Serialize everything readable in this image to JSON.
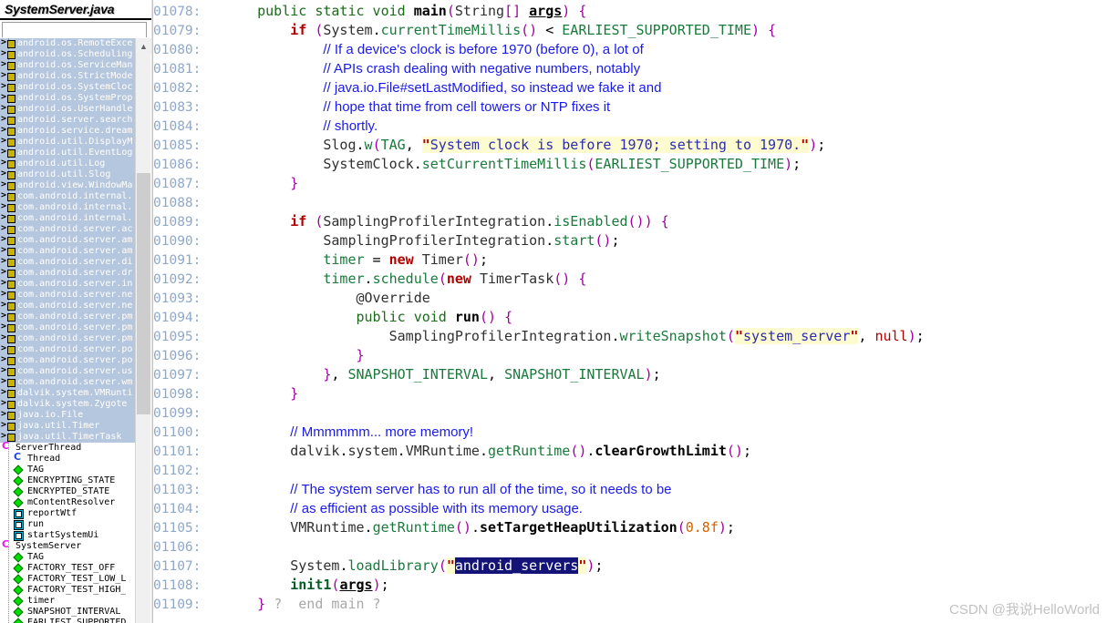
{
  "sidebar": {
    "file_tab_label": "SystemServer.java",
    "search_placeholder": "",
    "search_value": "",
    "icons": {
      "import": "import-icon",
      "class": "class-icon",
      "superclass": "superclass-icon",
      "field": "field-icon",
      "method": "method-icon",
      "scroll_up": "scroll-up-arrow-icon"
    },
    "scroll_up_glyph": "▲",
    "tree": [
      {
        "icon": "import",
        "label": "android.os.RemoteExce",
        "selected": true,
        "indent": 0
      },
      {
        "icon": "import",
        "label": "android.os.Scheduling",
        "selected": true,
        "indent": 0
      },
      {
        "icon": "import",
        "label": "android.os.ServiceMan",
        "selected": true,
        "indent": 0
      },
      {
        "icon": "import",
        "label": "android.os.StrictMode",
        "selected": true,
        "indent": 0
      },
      {
        "icon": "import",
        "label": "android.os.SystemCloc",
        "selected": true,
        "indent": 0
      },
      {
        "icon": "import",
        "label": "android.os.SystemProp",
        "selected": true,
        "indent": 0
      },
      {
        "icon": "import",
        "label": "android.os.UserHandle",
        "selected": true,
        "indent": 0
      },
      {
        "icon": "import",
        "label": "android.server.search",
        "selected": true,
        "indent": 0
      },
      {
        "icon": "import",
        "label": "android.service.dream",
        "selected": true,
        "indent": 0
      },
      {
        "icon": "import",
        "label": "android.util.DisplayM",
        "selected": true,
        "indent": 0
      },
      {
        "icon": "import",
        "label": "android.util.EventLog",
        "selected": true,
        "indent": 0
      },
      {
        "icon": "import",
        "label": "android.util.Log",
        "selected": true,
        "indent": 0
      },
      {
        "icon": "import",
        "label": "android.util.Slog",
        "selected": true,
        "indent": 0
      },
      {
        "icon": "import",
        "label": "android.view.WindowMa",
        "selected": true,
        "indent": 0
      },
      {
        "icon": "import",
        "label": "com.android.internal.",
        "selected": true,
        "indent": 0
      },
      {
        "icon": "import",
        "label": "com.android.internal.",
        "selected": true,
        "indent": 0
      },
      {
        "icon": "import",
        "label": "com.android.internal.",
        "selected": true,
        "indent": 0
      },
      {
        "icon": "import",
        "label": "com.android.server.ac",
        "selected": true,
        "indent": 0
      },
      {
        "icon": "import",
        "label": "com.android.server.am",
        "selected": true,
        "indent": 0
      },
      {
        "icon": "import",
        "label": "com.android.server.am",
        "selected": true,
        "indent": 0
      },
      {
        "icon": "import",
        "label": "com.android.server.di",
        "selected": true,
        "indent": 0
      },
      {
        "icon": "import",
        "label": "com.android.server.dr",
        "selected": true,
        "indent": 0
      },
      {
        "icon": "import",
        "label": "com.android.server.in",
        "selected": true,
        "indent": 0
      },
      {
        "icon": "import",
        "label": "com.android.server.ne",
        "selected": true,
        "indent": 0
      },
      {
        "icon": "import",
        "label": "com.android.server.ne",
        "selected": true,
        "indent": 0
      },
      {
        "icon": "import",
        "label": "com.android.server.pm",
        "selected": true,
        "indent": 0
      },
      {
        "icon": "import",
        "label": "com.android.server.pm",
        "selected": true,
        "indent": 0
      },
      {
        "icon": "import",
        "label": "com.android.server.pm",
        "selected": true,
        "indent": 0
      },
      {
        "icon": "import",
        "label": "com.android.server.po",
        "selected": true,
        "indent": 0
      },
      {
        "icon": "import",
        "label": "com.android.server.po",
        "selected": true,
        "indent": 0
      },
      {
        "icon": "import",
        "label": "com.android.server.us",
        "selected": true,
        "indent": 0
      },
      {
        "icon": "import",
        "label": "com.android.server.wm",
        "selected": true,
        "indent": 0
      },
      {
        "icon": "import",
        "label": "dalvik.system.VMRunti",
        "selected": true,
        "indent": 0
      },
      {
        "icon": "import",
        "label": "dalvik.system.Zygote",
        "selected": true,
        "indent": 0
      },
      {
        "icon": "import",
        "label": "java.io.File",
        "selected": true,
        "indent": 0
      },
      {
        "icon": "import",
        "label": "java.util.Timer",
        "selected": true,
        "indent": 0
      },
      {
        "icon": "import",
        "label": "java.util.TimerTask",
        "selected": true,
        "indent": 0
      },
      {
        "icon": "class",
        "label": "ServerThread",
        "selected": false,
        "indent": 0
      },
      {
        "icon": "superclass",
        "label": "Thread",
        "selected": false,
        "indent": 1
      },
      {
        "icon": "field",
        "label": "TAG",
        "selected": false,
        "indent": 1
      },
      {
        "icon": "field",
        "label": "ENCRYPTING_STATE",
        "selected": false,
        "indent": 1
      },
      {
        "icon": "field",
        "label": "ENCRYPTED_STATE",
        "selected": false,
        "indent": 1
      },
      {
        "icon": "field",
        "label": "mContentResolver",
        "selected": false,
        "indent": 1
      },
      {
        "icon": "method",
        "label": "reportWtf",
        "selected": false,
        "indent": 1
      },
      {
        "icon": "method",
        "label": "run",
        "selected": false,
        "indent": 1
      },
      {
        "icon": "method",
        "label": "startSystemUi",
        "selected": false,
        "indent": 1
      },
      {
        "icon": "class",
        "label": "SystemServer",
        "selected": false,
        "indent": 0
      },
      {
        "icon": "field",
        "label": "TAG",
        "selected": false,
        "indent": 1
      },
      {
        "icon": "field",
        "label": "FACTORY_TEST_OFF",
        "selected": false,
        "indent": 1
      },
      {
        "icon": "field",
        "label": "FACTORY_TEST_LOW_L",
        "selected": false,
        "indent": 1
      },
      {
        "icon": "field",
        "label": "FACTORY_TEST_HIGH_",
        "selected": false,
        "indent": 1
      },
      {
        "icon": "field",
        "label": "timer",
        "selected": false,
        "indent": 1
      },
      {
        "icon": "field",
        "label": "SNAPSHOT_INTERVAL",
        "selected": false,
        "indent": 1
      },
      {
        "icon": "field",
        "label": "EARLIEST_SUPPORTED",
        "selected": false,
        "indent": 1
      }
    ]
  },
  "editor": {
    "first_line_number": 1078,
    "selection_text": "android_servers",
    "lines": [
      {
        "n": "01078:",
        "html": "    <span class='kw2'>public static void</span> <span class='mthb'>main</span><span class='br'>(</span><span class='typ'>String</span><span class='br'>[]</span> <span class='und'>args</span><span class='br'>)</span> <span class='br'>{</span>"
      },
      {
        "n": "01079:",
        "html": "        <span class='kw'>if</span> <span class='br'>(</span><span class='typ'>System</span>.<span class='mth'>currentTimeMillis</span><span class='br'>()</span> &lt; <span class='fld'>EARLIEST_SUPPORTED_TIME</span><span class='br'>)</span> <span class='br'>{</span>"
      },
      {
        "n": "01080:",
        "html": "            <span class='cmt'>// If a device's clock is before 1970 (before 0), a lot of</span>"
      },
      {
        "n": "01081:",
        "html": "            <span class='cmt'>// APIs crash dealing with negative numbers, notably</span>"
      },
      {
        "n": "01082:",
        "html": "            <span class='cmt'>// java.io.File#setLastModified, so instead we fake it and</span>"
      },
      {
        "n": "01083:",
        "html": "            <span class='cmt'>// hope that time from cell towers or NTP fixes it</span>"
      },
      {
        "n": "01084:",
        "html": "            <span class='cmt'>// shortly.</span>"
      },
      {
        "n": "01085:",
        "html": "            <span class='typ'>Slog</span>.<span class='mth'>w</span><span class='br'>(</span><span class='fld'>TAG</span>, <span class='strq'>\"</span><span class='str'>System clock is before 1970; setting to 1970.</span><span class='strq'>\"</span><span class='br'>)</span>;"
      },
      {
        "n": "01086:",
        "html": "            <span class='typ'>SystemClock</span>.<span class='mth'>setCurrentTimeMillis</span><span class='br'>(</span><span class='fld'>EARLIEST_SUPPORTED_TIME</span><span class='br'>)</span>;"
      },
      {
        "n": "01087:",
        "html": "        <span class='br'>}</span>"
      },
      {
        "n": "01088:",
        "html": ""
      },
      {
        "n": "01089:",
        "html": "        <span class='kw'>if</span> <span class='br'>(</span><span class='typ'>SamplingProfilerIntegration</span>.<span class='mth'>isEnabled</span><span class='br'>())</span> <span class='br'>{</span>"
      },
      {
        "n": "01090:",
        "html": "            <span class='typ'>SamplingProfilerIntegration</span>.<span class='mth'>start</span><span class='br'>()</span>;"
      },
      {
        "n": "01091:",
        "html": "            <span class='fld'>timer</span> = <span class='kw'>new</span> <span class='typ'>Timer</span><span class='br'>()</span>;"
      },
      {
        "n": "01092:",
        "html": "            <span class='fld'>timer</span>.<span class='mth'>schedule</span><span class='br'>(</span><span class='kw'>new</span> <span class='typ'>TimerTask</span><span class='br'>()</span> <span class='br'>{</span>"
      },
      {
        "n": "01093:",
        "html": "                <span class='ann'>@Override</span>"
      },
      {
        "n": "01094:",
        "html": "                <span class='kw2'>public void</span> <span class='mthb'>run</span><span class='br'>()</span> <span class='br'>{</span>"
      },
      {
        "n": "01095:",
        "html": "                    <span class='typ'>SamplingProfilerIntegration</span>.<span class='mth'>writeSnapshot</span><span class='br'>(</span><span class='strq'>\"</span><span class='str'>system_server</span><span class='strq'>\"</span>, <span class='nul'>null</span><span class='br'>)</span>;"
      },
      {
        "n": "01096:",
        "html": "                <span class='br'>}</span>"
      },
      {
        "n": "01097:",
        "html": "            <span class='br'>}</span>, <span class='fld'>SNAPSHOT_INTERVAL</span>, <span class='fld'>SNAPSHOT_INTERVAL</span><span class='br'>)</span>;"
      },
      {
        "n": "01098:",
        "html": "        <span class='br'>}</span>"
      },
      {
        "n": "01099:",
        "html": ""
      },
      {
        "n": "01100:",
        "html": "        <span class='cmt'>// Mmmmmm... more memory!</span>"
      },
      {
        "n": "01101:",
        "html": "        <span class='typ'>dalvik</span>.<span class='typ'>system</span>.<span class='typ'>VMRuntime</span>.<span class='mth'>getRuntime</span><span class='br'>()</span>.<span class='mthb'>clearGrowthLimit</span><span class='br'>()</span>;"
      },
      {
        "n": "01102:",
        "html": ""
      },
      {
        "n": "01103:",
        "html": "        <span class='cmt'>// The system server has to run all of the time, so it needs to be</span>"
      },
      {
        "n": "01104:",
        "html": "        <span class='cmt'>// as efficient as possible with its memory usage.</span>"
      },
      {
        "n": "01105:",
        "html": "        <span class='typ'>VMRuntime</span>.<span class='mth'>getRuntime</span><span class='br'>()</span>.<span class='mthb'>setTargetHeapUtilization</span><span class='br'>(</span><span class='num'>0.8f</span><span class='br'>)</span>;"
      },
      {
        "n": "01106:",
        "html": ""
      },
      {
        "n": "01107:",
        "html": "        <span class='typ'>System</span>.<span class='mth'>loadLibrary</span><span class='br'>(</span><span class='strq'>\"</span><span class='sel'>android_servers</span><span class='strq'>\"</span><span class='br'>)</span>;"
      },
      {
        "n": "01108:",
        "html": "        <span class='mthg'>init1</span><span class='br'>(</span><span class='und'>args</span><span class='br'>)</span>;"
      },
      {
        "n": "01109:",
        "html": "    <span class='br'>}</span> <span class='gry'>?  end main ?</span>"
      }
    ]
  },
  "watermark": {
    "text": "CSDN @我说HelloWorld"
  }
}
